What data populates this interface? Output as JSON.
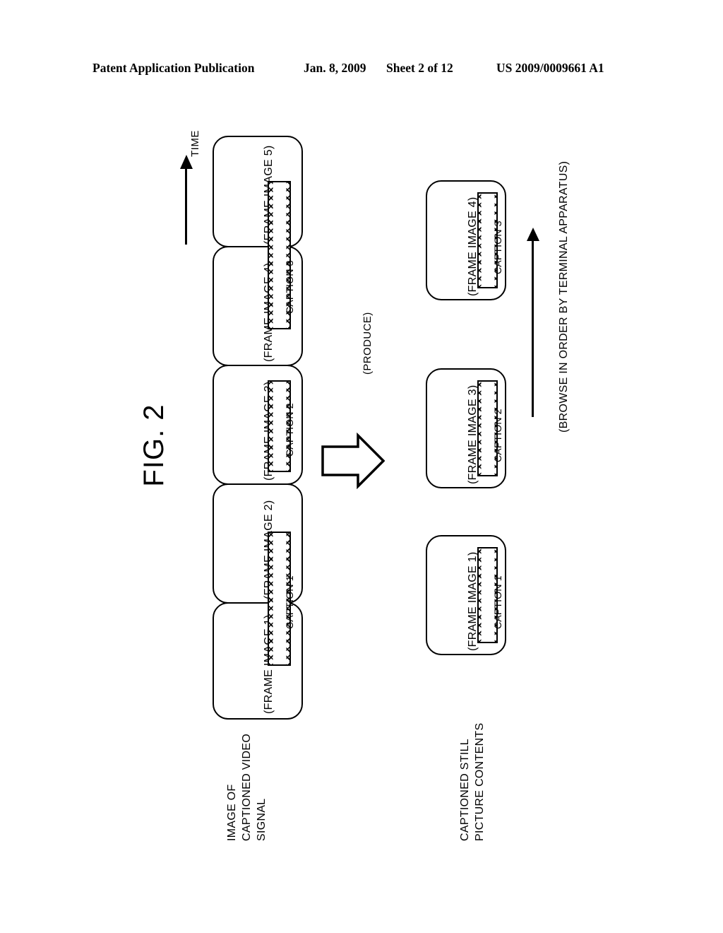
{
  "header": {
    "publication": "Patent Application Publication",
    "date": "Jan. 8, 2009",
    "sheet": "Sheet 2 of 12",
    "number": "US 2009/0009661 A1"
  },
  "figure": {
    "label": "FIG. 2"
  },
  "axis": {
    "time_label": "TIME",
    "time_arrow_icon": "up-arrow-icon"
  },
  "video_signal_row": {
    "group_label_line1": "IMAGE OF",
    "group_label_line2": "CAPTIONED VIDEO",
    "group_label_line3": "SIGNAL",
    "frames": [
      {
        "label": "(FRAME IMAGE 1)"
      },
      {
        "label": "(FRAME IMAGE 2)"
      },
      {
        "label": "(FRAME IMAGE 3)"
      },
      {
        "label": "(FRAME IMAGE 4)"
      },
      {
        "label": "(FRAME IMAGE 5)"
      }
    ],
    "captions": [
      {
        "label": "CAPTION 1",
        "spans_frames": "1-2"
      },
      {
        "label": "CAPTION 2",
        "spans_frames": "3"
      },
      {
        "label": "CAPTION 3",
        "spans_frames": "4-5"
      }
    ]
  },
  "produce": {
    "label": "(PRODUCE)",
    "arrow_icon": "block-arrow-right-icon"
  },
  "still_picture_row": {
    "group_label_line1": "CAPTIONED STILL",
    "group_label_line2": "PICTURE CONTENTS",
    "items": [
      {
        "frame_label": "(FRAME IMAGE 1)",
        "caption_label": "CAPTION 1"
      },
      {
        "frame_label": "(FRAME IMAGE 3)",
        "caption_label": "CAPTION 2"
      },
      {
        "frame_label": "(FRAME IMAGE 4)",
        "caption_label": "CAPTION 3"
      }
    ]
  },
  "browse": {
    "label": "(BROWSE IN ORDER BY TERMINAL APPARATUS)",
    "arrow_icon": "up-arrow-icon"
  },
  "colors": {
    "ink": "#000000",
    "paper": "#ffffff"
  }
}
